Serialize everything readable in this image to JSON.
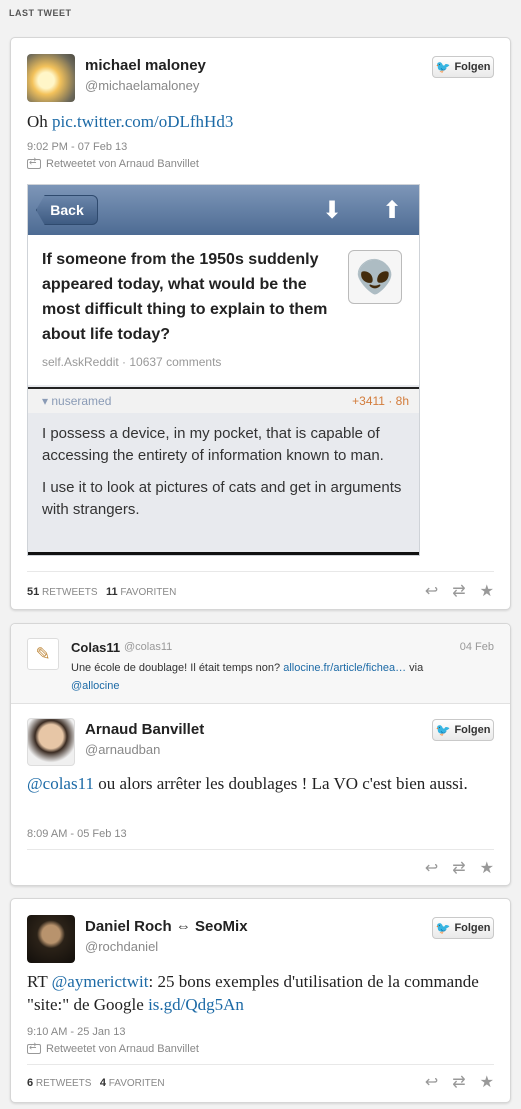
{
  "section_label": "LAST TWEET",
  "tweets": [
    {
      "name": "michael maloney",
      "handle": "@michaelamaloney",
      "follow_label": "Folgen",
      "text_prefix": "Oh ",
      "text_link": "pic.twitter.com/oDLfhHd3",
      "time": "9:02 PM - 07 Feb 13",
      "retweeted_by": "Retweetet von Arnaud Banvillet",
      "retweets_count": "51",
      "retweets_label": "RETWEETS",
      "favorites_count": "11",
      "favorites_label": "FAVORITEN",
      "embedded": {
        "back_label": "Back",
        "question": "If someone from the 1950s suddenly appeared today, what would be the most difficult thing to explain to them about life today?",
        "question_meta": "self.AskReddit · 10637 comments",
        "comment_user": "▾ nuseramed",
        "comment_score": "+3411 · 8h",
        "comment_p1": "I possess a device, in my pocket, that is capable of accessing the entirety of information known to man.",
        "comment_p2": "I use it to look at pictures of cats and get in arguments with strangers."
      }
    },
    {
      "quote": {
        "name": "Colas11",
        "handle": "@colas11",
        "date": "04 Feb",
        "text": "Une école de doublage! Il était temps non? ",
        "link": "allocine.fr/article/fichea…",
        "via": " via",
        "mention": "@allocine"
      },
      "name": "Arnaud Banvillet",
      "handle": "@arnaudban",
      "follow_label": "Folgen",
      "text_mention": "@colas11",
      "text_rest": " ou alors arrêter les doublages ! La VO c'est bien aussi.",
      "time": "8:09 AM - 05 Feb 13"
    },
    {
      "name": "Daniel Roch ⇔ SeoMix",
      "handle": "@rochdaniel",
      "follow_label": "Folgen",
      "text_prefix": "RT ",
      "text_mention": "@aymerictwit",
      "text_mid": ": 25 bons exemples d'utilisation de la commande \"site:\" de Google ",
      "text_link": "is.gd/Qdg5An",
      "time": "9:10 AM - 25 Jan 13",
      "retweeted_by": "Retweetet von Arnaud Banvillet",
      "retweets_count": "6",
      "retweets_label": "RETWEETS",
      "favorites_count": "4",
      "favorites_label": "FAVORITEN"
    }
  ],
  "icons": {
    "reply": "reply-icon",
    "retweet": "retweet-icon",
    "favorite": "star-icon",
    "bird": "twitter-bird-icon"
  },
  "colors": {
    "link": "#1c6aa6",
    "twitter_blue": "#2aa9e0"
  }
}
